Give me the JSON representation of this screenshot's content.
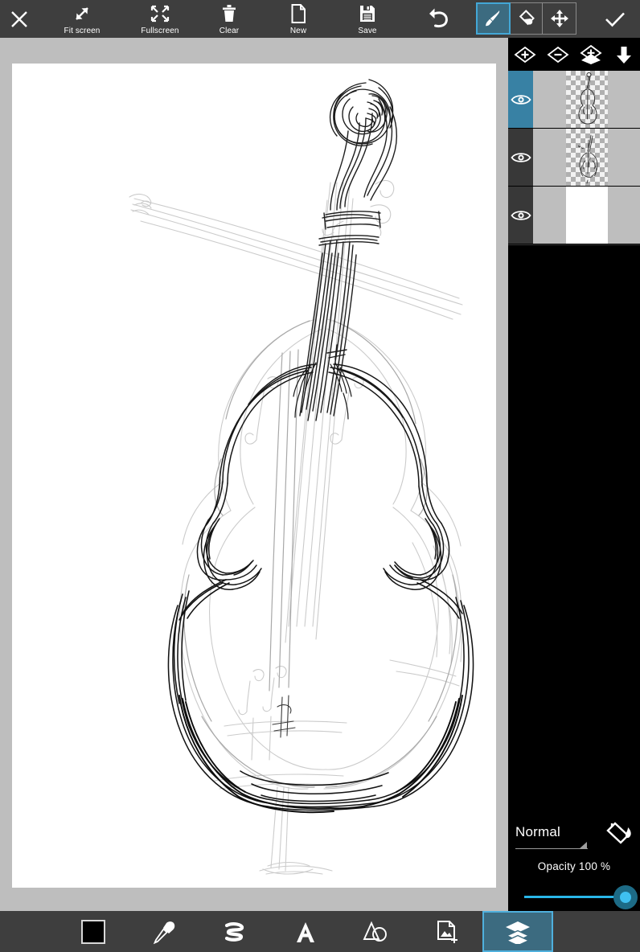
{
  "app": {
    "name": "sketch-drawing-app",
    "accent_blue": "#3881a4",
    "accent_cyan": "#29b6e8",
    "toolbar_bg": "#3e3e3e",
    "panel_bg": "#000000",
    "canvas_bg": "#ffffff",
    "workspace_bg": "#bebebe"
  },
  "topbar": {
    "close_label": "close-icon",
    "buttons": [
      {
        "id": "fit-screen",
        "label": "Fit screen",
        "icon": "diagonal-arrows-icon"
      },
      {
        "id": "fullscreen",
        "label": "Fullscreen",
        "icon": "fullscreen-icon"
      },
      {
        "id": "clear",
        "label": "Clear",
        "icon": "trash-icon"
      },
      {
        "id": "new",
        "label": "New",
        "icon": "page-icon"
      },
      {
        "id": "save",
        "label": "Save",
        "icon": "floppy-disk-icon"
      }
    ],
    "undo": {
      "id": "undo",
      "label": "Undo",
      "icon": "undo-arrow-icon"
    },
    "tools": [
      {
        "id": "brush",
        "icon": "paintbrush-icon",
        "selected": true
      },
      {
        "id": "eraser",
        "icon": "eraser-icon",
        "selected": false
      },
      {
        "id": "move",
        "icon": "move-arrows-icon",
        "selected": false
      }
    ],
    "confirm": {
      "id": "confirm",
      "icon": "checkmark-icon"
    }
  },
  "canvas": {
    "artwork_title": "double-bass-sketch",
    "description": "Pencil sketch of an upright double bass: scroll, pegbox, neck, fingerboard, bouts, f-holes, bridge and endpin, drawn with dark ink strokes over faint grey construction lines."
  },
  "layerpanel": {
    "header_buttons": [
      {
        "id": "add-layer",
        "icon": "diamond-plus-icon"
      },
      {
        "id": "delete-layer",
        "icon": "diamond-minus-icon"
      },
      {
        "id": "duplicate-layer",
        "icon": "stacked-diamond-plus-icon"
      },
      {
        "id": "merge-down",
        "icon": "down-arrow-icon"
      }
    ],
    "layers": [
      {
        "id": "layer-3",
        "visible": true,
        "selected": true,
        "transparent": true,
        "content": "dark-ink-bass-outline"
      },
      {
        "id": "layer-2",
        "visible": true,
        "selected": false,
        "transparent": true,
        "content": "light-pencil-bass-sketch"
      },
      {
        "id": "layer-1",
        "visible": true,
        "selected": false,
        "transparent": false,
        "content": "white-background"
      }
    ],
    "blend": {
      "mode": "Normal",
      "bucket_icon": "paint-bucket-icon",
      "opacity_label": "Opacity  100 %",
      "opacity_value": 100
    }
  },
  "bottombar": {
    "items": [
      {
        "id": "color",
        "icon": "color-swatch",
        "color": "#000000",
        "selected": false
      },
      {
        "id": "eyedropper",
        "icon": "eyedropper-icon",
        "selected": false
      },
      {
        "id": "brush-settings",
        "icon": "squiggle-brush-icon",
        "selected": false
      },
      {
        "id": "text",
        "icon": "text-a-icon",
        "selected": false
      },
      {
        "id": "shapes",
        "icon": "shapes-icon",
        "selected": false
      },
      {
        "id": "add-image",
        "icon": "add-image-icon",
        "selected": false
      },
      {
        "id": "layers",
        "icon": "layers-stack-icon",
        "selected": true
      }
    ]
  }
}
